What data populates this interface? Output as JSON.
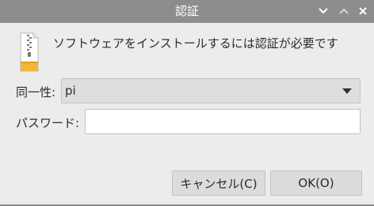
{
  "window": {
    "title": "認証"
  },
  "titlebar_buttons": {
    "minimize_icon": "chevron-down-icon",
    "maximize_icon": "chevron-up-icon",
    "close_icon": "close-icon"
  },
  "dialog": {
    "icon": "package-archive-icon",
    "message": "ソフトウェアをインストールするには認証が必要です"
  },
  "identity": {
    "label": "同一性:",
    "selected_value": "pi"
  },
  "password": {
    "label": "パスワード:",
    "value": ""
  },
  "buttons": {
    "cancel_label": "キャンセル(C)",
    "ok_label": "OK(O)"
  },
  "colors": {
    "titlebar": "#8d8d8d",
    "background": "#ececec",
    "button": "#dcdcdc"
  }
}
